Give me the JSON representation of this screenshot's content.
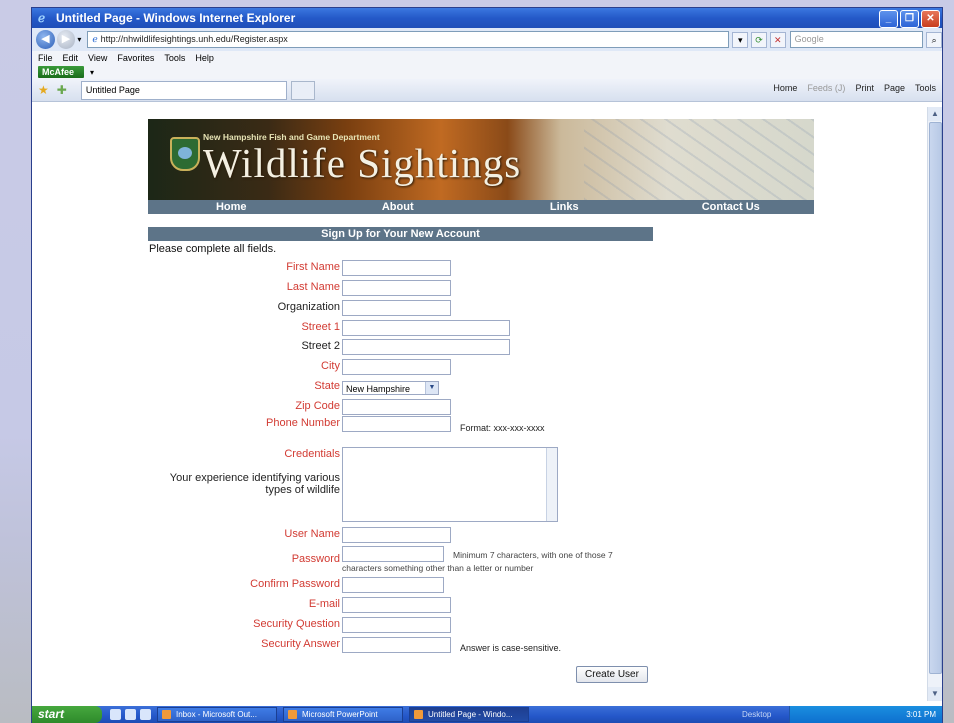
{
  "window": {
    "title": "Untitled Page - Windows Internet Explorer",
    "url": "http://nhwildlifesightings.unh.edu/Register.aspx",
    "search_placeholder": "Google",
    "menus": [
      "File",
      "Edit",
      "View",
      "Favorites",
      "Tools",
      "Help"
    ],
    "mcafee": "McAfee",
    "tab_title": "Untitled Page",
    "commands": {
      "home": "Home",
      "feeds": "Feeds (J)",
      "print": "Print",
      "page": "Page",
      "tools": "Tools"
    }
  },
  "banner": {
    "dept": "New Hampshire Fish and Game Department",
    "title": "Wildlife Sightings"
  },
  "nav": [
    "Home",
    "About",
    "Links",
    "Contact Us"
  ],
  "form": {
    "heading": "Sign Up for Your New Account",
    "note": "Please complete all fields.",
    "first_name": "First Name",
    "last_name": "Last Name",
    "organization": "Organization",
    "street1": "Street 1",
    "street2": "Street 2",
    "city": "City",
    "state": "State",
    "state_value": "New Hampshire",
    "zip": "Zip Code",
    "phone": "Phone Number",
    "phone_hint": "Format: xxx-xxx-xxxx",
    "credentials": "Credentials",
    "credentials_desc": "Your experience identifying various types of wildlife",
    "username": "User Name",
    "password": "Password",
    "password_hint_1": "Minimum 7 characters, with one of those 7",
    "password_hint_2": "characters something other than a letter or number",
    "confirm_password": "Confirm Password",
    "email": "E-mail",
    "security_question": "Security Question",
    "security_answer": "Security Answer",
    "answer_hint": "Answer is case-sensitive.",
    "submit": "Create User"
  },
  "taskbar": {
    "start": "start",
    "tasks": [
      "Inbox - Microsoft Out...",
      "Microsoft PowerPoint",
      "Untitled Page - Windo..."
    ],
    "desktop": "Desktop",
    "clock": "3:01 PM"
  }
}
